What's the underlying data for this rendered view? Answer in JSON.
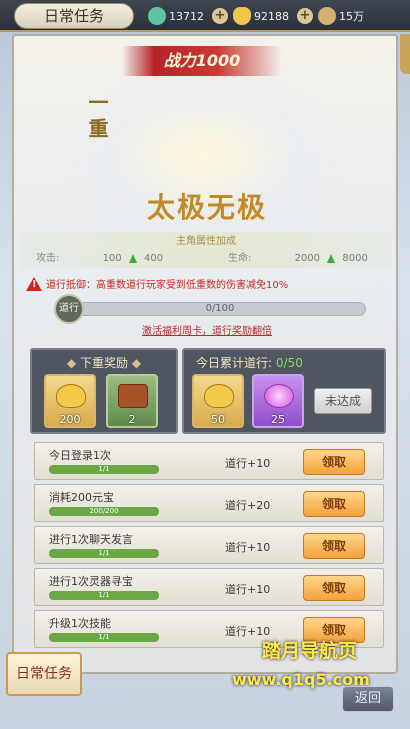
{
  "topbar": {
    "title": "日常任务",
    "resources": [
      {
        "icon": "jade-coin-icon",
        "value": "13712",
        "color": "#5fc4a0"
      },
      {
        "icon": "gold-ingot-icon",
        "value": "92188",
        "color": "#f1c54b"
      },
      {
        "icon": "copper-coin-icon",
        "value": "15万",
        "color": "#d6b170"
      }
    ]
  },
  "hero": {
    "power_label": "战力1000",
    "rank": "一重",
    "stage_name": "太极无极"
  },
  "attributes": {
    "title": "主角属性加成",
    "attack_label": "攻击:",
    "attack_from": "100",
    "attack_to": "400",
    "hp_label": "生命:",
    "hp_from": "2000",
    "hp_to": "8000"
  },
  "warning": {
    "text": "道行抵御：高重数道行玩家受到低重数的伤害减免10%"
  },
  "daoxing_progress": {
    "badge": "道行",
    "text": "0/100",
    "fraction": 0.0
  },
  "promo_link": "激活福利周卡，道行奖励翻倍",
  "next_reward": {
    "title": "下重奖励",
    "items": [
      {
        "icon": "gold-ingot-icon",
        "count": "200"
      },
      {
        "icon": "treasure-chest-icon",
        "count": "2"
      }
    ]
  },
  "daily_total": {
    "title_prefix": "今日累计道行:",
    "progress": "0/50",
    "items": [
      {
        "icon": "gold-ingot-icon",
        "count": "50"
      },
      {
        "icon": "purple-orb-icon",
        "count": "25"
      }
    ],
    "status_button": "未达成"
  },
  "tasks": [
    {
      "name": "今日登录1次",
      "progress": "1/1",
      "fraction": 1.0,
      "reward": "道行+10",
      "button": "领取"
    },
    {
      "name": "消耗200元宝",
      "progress": "200/200",
      "fraction": 1.0,
      "reward": "道行+20",
      "button": "领取"
    },
    {
      "name": "进行1次聊天发言",
      "progress": "1/1",
      "fraction": 1.0,
      "reward": "道行+10",
      "button": "领取"
    },
    {
      "name": "进行1次灵器寻宝",
      "progress": "1/1",
      "fraction": 1.0,
      "reward": "道行+10",
      "button": "领取"
    },
    {
      "name": "升级1次技能",
      "progress": "1/1",
      "fraction": 1.0,
      "reward": "道行+10",
      "button": "领取"
    }
  ],
  "bottom": {
    "nav_label": "日常任务",
    "return_label": "返回",
    "watermark_title": "踏月导航页",
    "watermark_url": "www.q1q5.com"
  }
}
